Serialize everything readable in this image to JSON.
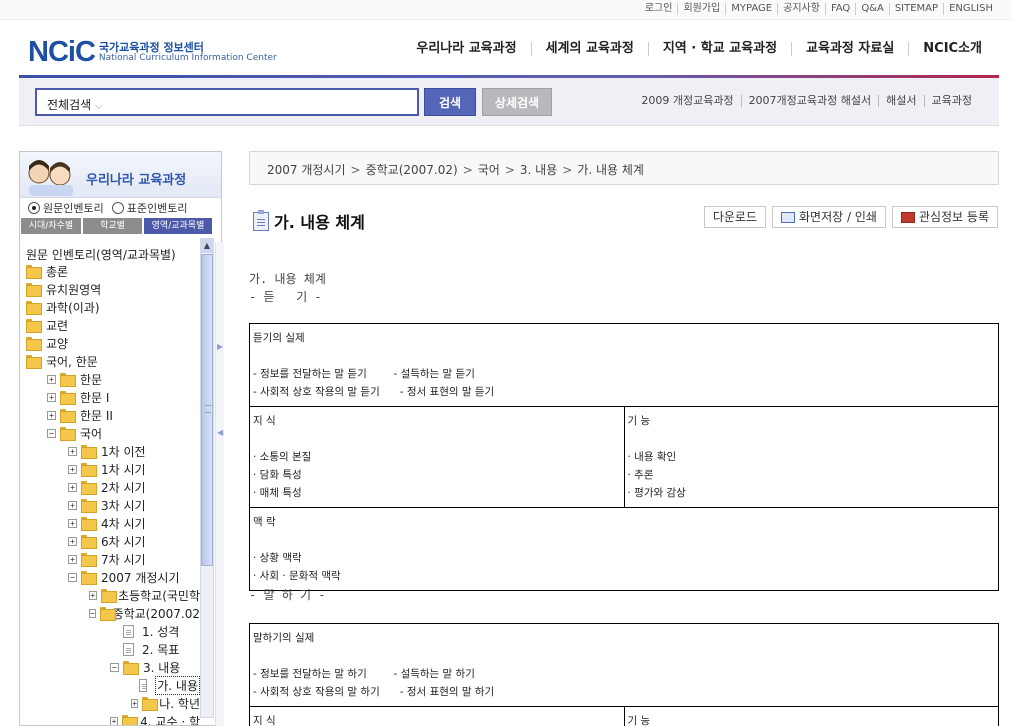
{
  "util_links": [
    "로그인",
    "회원가입",
    "MYPAGE",
    "공지사항",
    "FAQ",
    "Q&A",
    "SITEMAP",
    "ENGLISH"
  ],
  "logo": {
    "mark": "NCiC",
    "ko": "국가교육과정 정보센터",
    "en": "National Curriculum Information Center"
  },
  "gnb": [
    "우리나라 교육과정",
    "세계의 교육과정",
    "지역 · 학교 교육과정",
    "교육과정 자료실",
    "NCIC소개"
  ],
  "search": {
    "scope": "전체검색",
    "button": "검색",
    "advanced": "상세검색"
  },
  "quicklinks": [
    "2009 개정교육과정",
    "2007개정교육과정 해설서",
    "해설서",
    "교육과정"
  ],
  "left_panel": {
    "title": "우리나라 교육과정",
    "radios": [
      {
        "label": "원문인벤토리",
        "checked": true
      },
      {
        "label": "표준인벤토리",
        "checked": false
      }
    ],
    "tabs": [
      "시대/차수별",
      "학교별",
      "영역/교과목별"
    ],
    "tree_root": "원문 인벤토리(영역/교과목별)",
    "tree": [
      {
        "level": 0,
        "tog": "",
        "icon": "folder",
        "label": "총론"
      },
      {
        "level": 0,
        "tog": "",
        "icon": "folder",
        "label": "유치원영역"
      },
      {
        "level": 0,
        "tog": "",
        "icon": "folder",
        "label": "과학(이과)"
      },
      {
        "level": 0,
        "tog": "",
        "icon": "folder",
        "label": "교련"
      },
      {
        "level": 0,
        "tog": "",
        "icon": "folder",
        "label": "교양"
      },
      {
        "level": 0,
        "tog": "",
        "icon": "folder",
        "label": "국어, 한문"
      },
      {
        "level": 1,
        "tog": "+",
        "icon": "folder",
        "label": "한문"
      },
      {
        "level": 1,
        "tog": "+",
        "icon": "folder",
        "label": "한문 I"
      },
      {
        "level": 1,
        "tog": "+",
        "icon": "folder",
        "label": "한문 II"
      },
      {
        "level": 1,
        "tog": "−",
        "icon": "folder",
        "label": "국어"
      },
      {
        "level": 2,
        "tog": "+",
        "icon": "folder",
        "label": "1차 이전"
      },
      {
        "level": 2,
        "tog": "+",
        "icon": "folder",
        "label": "1차 시기"
      },
      {
        "level": 2,
        "tog": "+",
        "icon": "folder",
        "label": "2차 시기"
      },
      {
        "level": 2,
        "tog": "+",
        "icon": "folder",
        "label": "3차 시기"
      },
      {
        "level": 2,
        "tog": "+",
        "icon": "folder",
        "label": "4차 시기"
      },
      {
        "level": 2,
        "tog": "+",
        "icon": "folder",
        "label": "6차 시기"
      },
      {
        "level": 2,
        "tog": "+",
        "icon": "folder",
        "label": "7차 시기"
      },
      {
        "level": 2,
        "tog": "−",
        "icon": "folder",
        "label": "2007 개정시기"
      },
      {
        "level": 3,
        "tog": "+",
        "icon": "folder",
        "label": "초등학교(국민학"
      },
      {
        "level": 3,
        "tog": "−",
        "icon": "folder",
        "label": "중학교(2007.02"
      },
      {
        "level": 4,
        "tog": "",
        "icon": "doc",
        "label": "1. 성격"
      },
      {
        "level": 4,
        "tog": "",
        "icon": "doc",
        "label": "2. 목표"
      },
      {
        "level": 4,
        "tog": "−",
        "icon": "folder",
        "label": "3. 내용"
      },
      {
        "level": 5,
        "tog": "",
        "icon": "doc",
        "label": "가. 내용",
        "selected": true
      },
      {
        "level": 5,
        "tog": "+",
        "icon": "folder",
        "label": "나. 학년"
      },
      {
        "level": 4,
        "tog": "+",
        "icon": "folder",
        "label": "4. 교수 · 학"
      }
    ]
  },
  "breadcrumb": [
    "2007 개정시기",
    "중학교(2007.02)",
    "국어",
    "3. 내용",
    "가. 내용 체계"
  ],
  "page_title": "가. 내용 체계",
  "actions": {
    "download": "다운로드",
    "save_print": "화면저장 / 인쇄",
    "favorite": "관심정보 등록"
  },
  "intro": {
    "line1": "가. 내용 체계",
    "line2": "- 듣   기 -"
  },
  "section2_title": "- 말 하 기 -",
  "table1": {
    "practice_title": "듣기의 실제",
    "practice_line1": "- 정보를 전달하는 말 듣기        - 설득하는 말 듣기",
    "practice_line2": "- 사회적 상호 작용의 말 듣기      - 정서 표현의 말 듣기",
    "knowledge_title": "지 식",
    "knowledge_items": [
      "· 소통의 본질",
      "· 담화 특성",
      "· 매체 특성"
    ],
    "skill_title": "기 능",
    "skill_items": [
      "· 내용 확인",
      "· 추론",
      "· 평가와 감상"
    ],
    "context_title": "맥 락",
    "context_items": [
      "· 상황 맥락",
      "· 사회 · 문화적 맥락"
    ]
  },
  "table2": {
    "practice_title": "말하기의 실제",
    "practice_line1": "- 정보를 전달하는 말 하기        - 설득하는 말 하기",
    "practice_line2": "- 사회적 상호 작용의 말 하기      - 정서 표현의 말 하기",
    "knowledge_title": "지 식",
    "skill_title": "기 능"
  },
  "colors": {
    "brand_blue": "#1d4fa3",
    "search_border": "#4c5aa9",
    "accent_red": "#b3264b"
  }
}
